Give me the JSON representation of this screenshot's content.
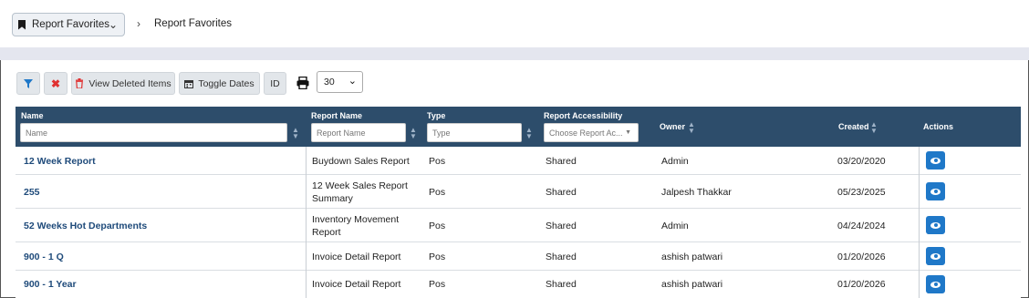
{
  "header": {
    "favorites_select": "Report Favorites",
    "breadcrumb_current": "Report Favorites"
  },
  "toolbar": {
    "view_deleted_label": "View Deleted Items",
    "toggle_dates_label": "Toggle Dates",
    "id_label": "ID",
    "page_size": "30"
  },
  "table": {
    "columns": {
      "name": "Name",
      "report_name": "Report Name",
      "type": "Type",
      "report_accessibility": "Report Accessibility",
      "owner": "Owner",
      "created": "Created",
      "actions": "Actions"
    },
    "filters": {
      "name_placeholder": "Name",
      "report_name_placeholder": "Report Name",
      "type_placeholder": "Type",
      "accessibility_placeholder": "Choose Report Ac..."
    },
    "rows": [
      {
        "name": "12 Week Report",
        "report_name_1": "Buydown Sales Report",
        "report_name_2": "",
        "type": "Pos",
        "accessibility": "Shared",
        "owner": "Admin",
        "created": "03/20/2020"
      },
      {
        "name": "255",
        "report_name_1": "12 Week Sales Report",
        "report_name_2": "Summary",
        "type": "Pos",
        "accessibility": "Shared",
        "owner": "Jalpesh Thakkar",
        "created": "05/23/2025"
      },
      {
        "name": "52 Weeks Hot Departments",
        "report_name_1": "Inventory Movement",
        "report_name_2": "Report",
        "type": "Pos",
        "accessibility": "Shared",
        "owner": "Admin",
        "created": "04/24/2024"
      },
      {
        "name": "900 - 1 Q",
        "report_name_1": "Invoice Detail Report",
        "report_name_2": "",
        "type": "Pos",
        "accessibility": "Shared",
        "owner": "ashish patwari",
        "created": "01/20/2026"
      },
      {
        "name": "900 - 1 Year",
        "report_name_1": "Invoice Detail Report",
        "report_name_2": "",
        "type": "Pos",
        "accessibility": "Shared",
        "owner": "ashish patwari",
        "created": "01/20/2026"
      }
    ]
  },
  "colors": {
    "header_bg": "#2d4d6b",
    "action_blue": "#1f78c8",
    "link": "#1e4a7a",
    "danger": "#e03131"
  }
}
